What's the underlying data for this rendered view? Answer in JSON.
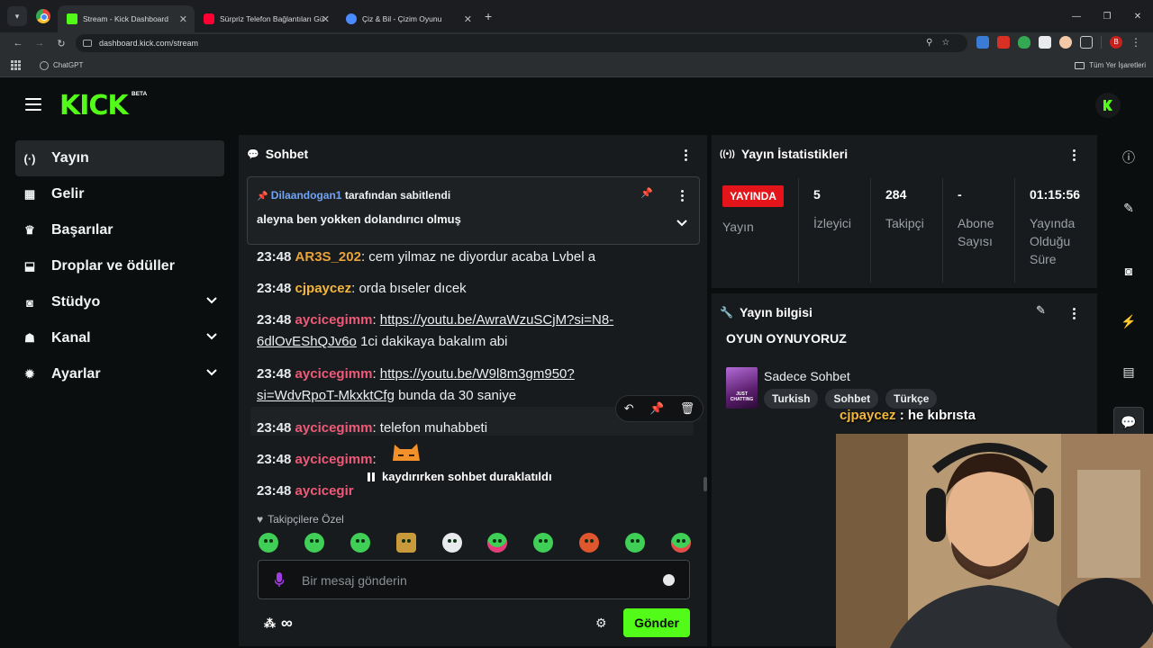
{
  "browser": {
    "tabs": [
      {
        "title": "Stream - Kick Dashboard",
        "active": true,
        "color": "#53fc18"
      },
      {
        "title": "Sürpriz Telefon Bağlantıları Gül",
        "active": false,
        "color": "#ff0033"
      },
      {
        "title": "Çiz & Bil - Çizim Oyunu",
        "active": false,
        "color": "#4a8cff"
      }
    ],
    "url": "dashboard.kick.com/stream",
    "bookmarks": [
      {
        "label": "ChatGPT"
      }
    ],
    "all_bookmarks_label": "Tüm Yer İşaretleri",
    "profile_initial": "B"
  },
  "kick": {
    "logo": "KICK",
    "beta": "BETA",
    "accent": "#53fc18"
  },
  "sidebar": {
    "items": [
      {
        "label": "Yayın",
        "icon": "broadcast-icon",
        "active": true,
        "expandable": false
      },
      {
        "label": "Gelir",
        "icon": "chart-icon",
        "active": false,
        "expandable": false
      },
      {
        "label": "Başarılar",
        "icon": "trophy-icon",
        "active": false,
        "expandable": false
      },
      {
        "label": "Droplar ve ödüller",
        "icon": "gift-icon",
        "active": false,
        "expandable": false
      },
      {
        "label": "Stüdyo",
        "icon": "studio-icon",
        "active": false,
        "expandable": true
      },
      {
        "label": "Kanal",
        "icon": "users-icon",
        "active": false,
        "expandable": true
      },
      {
        "label": "Ayarlar",
        "icon": "settings-icon",
        "active": false,
        "expandable": true
      }
    ]
  },
  "chat": {
    "title": "Sohbet",
    "pinned": {
      "user": "Dilaandogan1",
      "suffix": "tarafından sabitlendi",
      "message": "aleyna ben yokken dolandırıcı olmuş"
    },
    "messages": [
      {
        "time": "23:48",
        "user": "AR3S_202",
        "user_color": "#e8a23a",
        "text": "cem yilmaz ne diyordur acaba Lvbel a"
      },
      {
        "time": "23:48",
        "user": "cjpaycez",
        "user_color": "#f4b73b",
        "text": "orda bıseler dıcek"
      },
      {
        "time": "23:48",
        "user": "aycicegimm",
        "user_color": "#ef5a78",
        "link": "https://youtu.be/AwraWzuSCjM?si=N8-6dlOvEShQJv6o",
        "link_line1": "https://youtu.be/AwraWzuSCjM?si=N8-",
        "link_line2": "6dlOvEShQJv6o",
        "text": "1ci dakikaya bakalım abi"
      },
      {
        "time": "23:48",
        "user": "aycicegimm",
        "user_color": "#ef5a78",
        "link": "https://youtu.be/W9l8m3gm950?si=WdvRpoT-MkxktCfg",
        "link_line1": "https://youtu.be/W9l8m3gm950?",
        "link_line2": "si=WdvRpoT-MkxktCfg",
        "text": "bunda da 30 saniye"
      },
      {
        "time": "23:48",
        "user": "aycicegimm",
        "user_color": "#ef5a78",
        "text": "telefon muhabbeti"
      },
      {
        "time": "23:48",
        "user": "aycicegimm",
        "user_color": "#ef5a78",
        "text": ""
      },
      {
        "time": "23:48",
        "user": "aycicegir",
        "user_color": "#ef5a78",
        "text": ""
      }
    ],
    "paused_label": "kaydırırken sohbet duraklatıldı",
    "followers_only": "Takipçilere Özel",
    "input_placeholder": "Bir mesaj gönderin",
    "send_label": "Gönder",
    "infinity": "∞"
  },
  "stats": {
    "title": "Yayın İstatistikleri",
    "live_label": "YAYINDA",
    "cells": [
      {
        "value": "",
        "label": "Yayın"
      },
      {
        "value": "5",
        "label": "İzleyici"
      },
      {
        "value": "284",
        "label": "Takipçi"
      },
      {
        "value": "-",
        "label": "Abone Sayısı"
      },
      {
        "value": "01:15:56",
        "label": "Yayında Olduğu Süre"
      }
    ]
  },
  "stream_info": {
    "title": "Yayın bilgisi",
    "stream_title": "OYUN OYNUYORUZ",
    "category": "Sadece Sohbet",
    "category_thumb_text": "JUST CHATTING",
    "tags": [
      "Turkish",
      "Sohbet",
      "Türkçe"
    ]
  },
  "overlay": {
    "user": "cjpaycez",
    "text": ": he kıbrısta"
  }
}
